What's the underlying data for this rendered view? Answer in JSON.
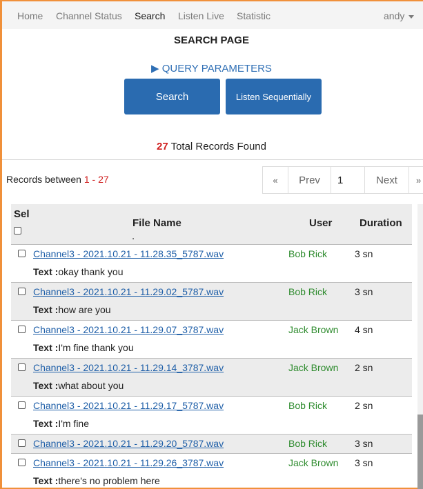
{
  "nav": {
    "links": [
      "Home",
      "Channel Status",
      "Search",
      "Listen Live",
      "Statistic"
    ],
    "user": "andy"
  },
  "page_title": "SEARCH PAGE",
  "query_toggle": "▶ QUERY PARAMETERS",
  "buttons": {
    "search": "Search",
    "listen_sequentially": "Listen Sequentially"
  },
  "total": {
    "count": "27",
    "label": " Total Records Found"
  },
  "records": {
    "label": "Records between ",
    "range": "1 - 27"
  },
  "pagination": {
    "first": "«",
    "prev": "Prev",
    "page": "1",
    "next": "Next",
    "last": "»"
  },
  "table": {
    "headers": {
      "sel": "Sel",
      "file": "File Name",
      "user": "User",
      "duration": "Duration",
      "partial_text": "."
    },
    "text_prefix": "Text :",
    "rows": [
      {
        "file": "Channel3 - 2021.10.21 - 11.28.35_5787.wav",
        "user": "Bob Rick",
        "duration": "3 sn",
        "text": "okay thank you"
      },
      {
        "file": "Channel3 - 2021.10.21 - 11.29.02_5787.wav",
        "user": "Bob Rick",
        "duration": "3 sn",
        "text": "how are you"
      },
      {
        "file": "Channel3 - 2021.10.21 - 11.29.07_3787.wav",
        "user": "Jack Brown",
        "duration": "4 sn",
        "text": "I'm fine thank you"
      },
      {
        "file": "Channel3 - 2021.10.21 - 11.29.14_3787.wav",
        "user": "Jack Brown",
        "duration": "2 sn",
        "text": "what about you"
      },
      {
        "file": "Channel3 - 2021.10.21 - 11.29.17_5787.wav",
        "user": "Bob Rick",
        "duration": "2 sn",
        "text": "I'm fine"
      },
      {
        "file": "Channel3 - 2021.10.21 - 11.29.20_5787.wav",
        "user": "Bob Rick",
        "duration": "3 sn",
        "text": ""
      },
      {
        "file": "Channel3 - 2021.10.21 - 11.29.26_3787.wav",
        "user": "Jack Brown",
        "duration": "3 sn",
        "text": "there's no problem here"
      }
    ]
  },
  "colors": {
    "accent": "#2a6bb0",
    "frame": "#f0903a",
    "count_red": "#d02020",
    "user_green": "#2e8b2e",
    "link_blue": "#1f5fa8"
  }
}
